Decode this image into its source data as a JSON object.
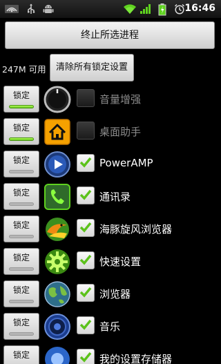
{
  "status_bar": {
    "time": "16:46",
    "icons": [
      "wifi-notification-icon",
      "usb-icon",
      "android-debug-icon",
      "wifi-signal-icon",
      "cell-signal-icon",
      "battery-icon",
      "alarm-icon"
    ]
  },
  "end_button": {
    "label": "终止所选进程"
  },
  "memory": {
    "text": "247M 可用",
    "clear_label": "清除所有锁定设置"
  },
  "lock_label": "锁定",
  "processes": [
    {
      "lock": "锁定",
      "locked": true,
      "checked": false,
      "name": "音量增强",
      "icon": "volume-knob-icon"
    },
    {
      "lock": "锁定",
      "locked": true,
      "checked": false,
      "name": "桌面助手",
      "icon": "home-icon"
    },
    {
      "lock": "锁定",
      "locked": false,
      "checked": true,
      "name": "PowerAMP",
      "icon": "play-icon"
    },
    {
      "lock": "锁定",
      "locked": false,
      "checked": true,
      "name": "通讯录",
      "icon": "phone-icon"
    },
    {
      "lock": "锁定",
      "locked": false,
      "checked": true,
      "name": "海豚旋风浏览器",
      "icon": "dolphin-browser-icon"
    },
    {
      "lock": "锁定",
      "locked": false,
      "checked": true,
      "name": "快速设置",
      "icon": "settings-gear-icon"
    },
    {
      "lock": "锁定",
      "locked": false,
      "checked": true,
      "name": "浏览器",
      "icon": "globe-icon"
    },
    {
      "lock": "锁定",
      "locked": false,
      "checked": true,
      "name": "音乐",
      "icon": "music-speaker-icon"
    },
    {
      "lock": "锁定",
      "locked": false,
      "checked": true,
      "name": "我的设置存储器",
      "icon": "storage-icon"
    }
  ],
  "colors": {
    "lock_on": "#7ee02a",
    "check": "#5cc21b",
    "checked_text": "#ffffff",
    "unchecked_text": "#8c8c8c"
  }
}
